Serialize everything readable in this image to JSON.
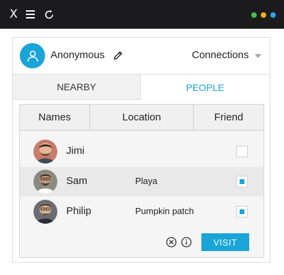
{
  "titlebar": {
    "close_glyph": "X",
    "icons": [
      "close-icon",
      "menu-icon",
      "refresh-icon"
    ],
    "dot_colors": [
      "#4cbb4c",
      "#f0b020",
      "#2aa4e6"
    ]
  },
  "header": {
    "username": "Anonymous",
    "connections_label": "Connections"
  },
  "tabs": [
    {
      "label": "NEARBY",
      "active": false
    },
    {
      "label": "PEOPLE",
      "active": true
    }
  ],
  "table": {
    "columns": [
      "Names",
      "Location",
      "Friend"
    ],
    "rows": [
      {
        "name": "Jimi",
        "location": "",
        "friend": false
      },
      {
        "name": "Sam",
        "location": "Playa",
        "friend": true
      },
      {
        "name": "Philip",
        "location": "Pumpkin patch",
        "friend": true
      }
    ]
  },
  "actions": {
    "visit_label": "VISIT"
  },
  "colors": {
    "accent": "#1aa4d8",
    "titlebar": "#1b1b1d"
  }
}
